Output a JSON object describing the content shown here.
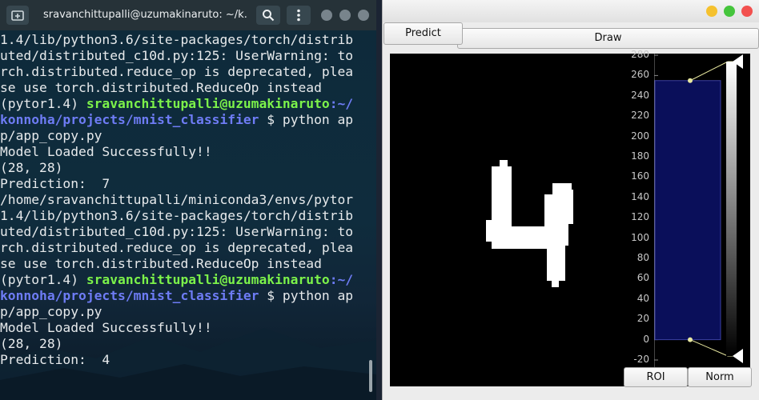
{
  "terminal": {
    "title": "sravanchittupalli@uzumakinaruto: ~/k...",
    "lines": [
      [
        {
          "t": "1.4/lib/python3.6/site-packages/torch/distrib",
          "c": ""
        }
      ],
      [
        {
          "t": "uted/distributed_c10d.py:125: UserWarning: to",
          "c": ""
        }
      ],
      [
        {
          "t": "rch.distributed.reduce_op is deprecated, plea",
          "c": ""
        }
      ],
      [
        {
          "t": "se use torch.distributed.ReduceOp instead",
          "c": ""
        }
      ],
      [
        {
          "t": "(pytor1.4) ",
          "c": ""
        },
        {
          "t": "sravanchittupalli@uzumakinaruto",
          "c": "c-user"
        },
        {
          "t": ":~/",
          "c": "c-path"
        }
      ],
      [
        {
          "t": "konnoha/projects/mnist_classifier",
          "c": "c-path"
        },
        {
          "t": " $ python ap",
          "c": ""
        }
      ],
      [
        {
          "t": "p/app_copy.py",
          "c": ""
        }
      ],
      [
        {
          "t": "Model Loaded Successfully!!",
          "c": ""
        }
      ],
      [
        {
          "t": "(28, 28)",
          "c": ""
        }
      ],
      [
        {
          "t": "Prediction:  7",
          "c": ""
        }
      ],
      [
        {
          "t": "/home/sravanchittupalli/miniconda3/envs/pytor",
          "c": ""
        }
      ],
      [
        {
          "t": "1.4/lib/python3.6/site-packages/torch/distrib",
          "c": ""
        }
      ],
      [
        {
          "t": "uted/distributed_c10d.py:125: UserWarning: to",
          "c": ""
        }
      ],
      [
        {
          "t": "rch.distributed.reduce_op is deprecated, plea",
          "c": ""
        }
      ],
      [
        {
          "t": "se use torch.distributed.ReduceOp instead",
          "c": ""
        }
      ],
      [
        {
          "t": "(pytor1.4) ",
          "c": ""
        },
        {
          "t": "sravanchittupalli@uzumakinaruto",
          "c": "c-user"
        },
        {
          "t": ":~/",
          "c": "c-path"
        }
      ],
      [
        {
          "t": "konnoha/projects/mnist_classifier",
          "c": "c-path"
        },
        {
          "t": " $ python ap",
          "c": ""
        }
      ],
      [
        {
          "t": "p/app_copy.py",
          "c": ""
        }
      ],
      [
        {
          "t": "Model Loaded Successfully!!",
          "c": ""
        }
      ],
      [
        {
          "t": "(28, 28)",
          "c": ""
        }
      ],
      [
        {
          "t": "Prediction:  4",
          "c": ""
        }
      ]
    ]
  },
  "app": {
    "predict_label": "Predict",
    "draw_label": "Draw",
    "roi_label": "ROI",
    "norm_label": "Norm",
    "histogram": {
      "ticks": [
        "280",
        "260",
        "240",
        "220",
        "200",
        "180",
        "160",
        "140",
        "120",
        "100",
        "80",
        "60",
        "40",
        "20",
        "0",
        "-20"
      ],
      "region_range": [
        0,
        255
      ]
    }
  },
  "colors": {
    "user_prompt": "#7cf24a",
    "path_prompt": "#6e7cf5",
    "histogram_region": "#0a0f5a",
    "win_yellow": "#f5c12e",
    "win_green": "#45c53c",
    "win_red": "#f2504e"
  },
  "icons": [
    "new-tab-icon",
    "search-icon",
    "kebab-menu-icon",
    "triangle-handle-icon"
  ]
}
